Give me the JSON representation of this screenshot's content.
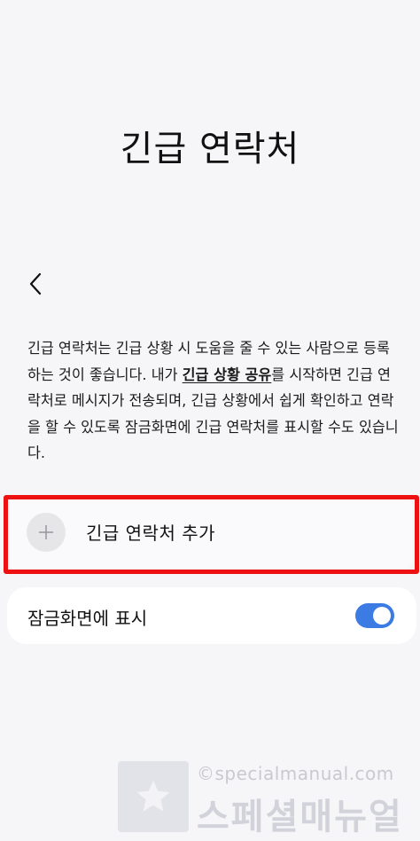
{
  "header": {
    "title": "긴급 연락처"
  },
  "description": {
    "part1": "긴급 연락처는 긴급 상황 시 도움을 줄 수 있는 사람으로 등록하는 것이 좋습니다. 내가 ",
    "link": "긴급 상황 공유",
    "part2": "를 시작하면 긴급 연락처로 메시지가 전송되며, 긴급 상황에서 쉽게 확인하고 연락을 할 수 있도록 잠금화면에 긴급 연락처를 표시할 수도 있습니다."
  },
  "add_contact": {
    "icon": "plus-icon",
    "label": "긴급 연락처 추가"
  },
  "lock_screen": {
    "label": "잠금화면에 표시",
    "toggle_on": true,
    "toggle_color": "#3d7be4"
  },
  "watermark": {
    "url": "©specialmanual.com",
    "name": "스페셜매뉴얼"
  },
  "colors": {
    "background": "#f6f6f8",
    "highlight": "#ee1111",
    "accent": "#3d7be4"
  }
}
